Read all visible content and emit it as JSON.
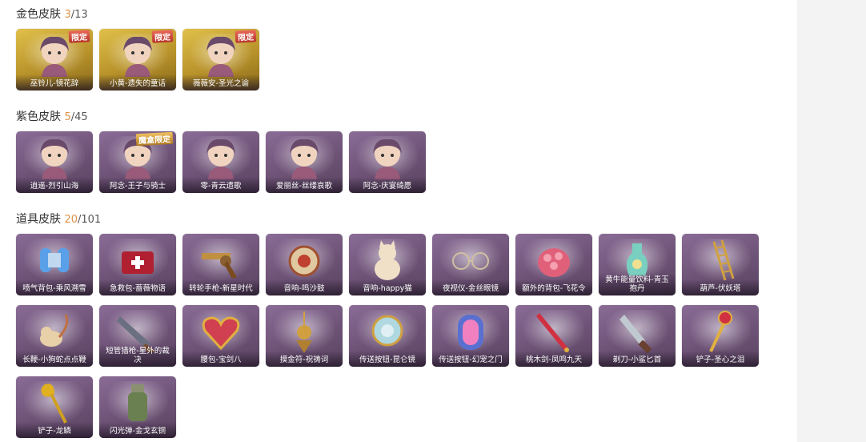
{
  "sections": [
    {
      "title": "金色皮肤",
      "owned": "3",
      "total": "/13",
      "items": [
        {
          "label": "巫铃儿-镜花辞",
          "badge": "限定",
          "icon": "character-portrait"
        },
        {
          "label": "小黄-遗失的童话",
          "badge": "限定",
          "icon": "character-portrait"
        },
        {
          "label": "薇薇安-圣光之谕",
          "badge": "限定",
          "icon": "character-portrait"
        }
      ]
    },
    {
      "title": "紫色皮肤",
      "owned": "5",
      "total": "/45",
      "items": [
        {
          "label": "逍遥-烈引山海",
          "badge": "",
          "icon": "character-portrait"
        },
        {
          "label": "阿念-王子与骑士",
          "badge": "魔盒限定",
          "icon": "character-portrait"
        },
        {
          "label": "零-青云遗歌",
          "badge": "",
          "icon": "character-portrait"
        },
        {
          "label": "爱丽丝-丝缕哀歌",
          "badge": "",
          "icon": "character-portrait"
        },
        {
          "label": "阿念-庆宴绮愿",
          "badge": "",
          "icon": "character-portrait"
        }
      ]
    },
    {
      "title": "道具皮肤",
      "owned": "20",
      "total": "/101",
      "items": [
        {
          "label": "喷气背包-乘风溯雪",
          "badge": "",
          "icon": "jetpack-icon"
        },
        {
          "label": "急救包-蔷薇物语",
          "badge": "",
          "icon": "medkit-icon"
        },
        {
          "label": "转轮手枪-新星时代",
          "badge": "",
          "icon": "revolver-icon"
        },
        {
          "label": "音响-鸣沙鼓",
          "badge": "",
          "icon": "drum-icon"
        },
        {
          "label": "音响-happy猫",
          "badge": "",
          "icon": "cat-speaker-icon"
        },
        {
          "label": "夜视仪-金丝眼镜",
          "badge": "",
          "icon": "glasses-icon"
        },
        {
          "label": "额外的背包-飞花令",
          "badge": "",
          "icon": "flower-backpack-icon"
        },
        {
          "label": "黄牛能量饮料-青玉抱丹",
          "badge": "",
          "icon": "potion-icon"
        },
        {
          "label": "葫芦-伏妖塔",
          "badge": "",
          "icon": "ladder-icon"
        },
        {
          "label": "长鞭-小狗蛇点点鞭",
          "badge": "",
          "icon": "whip-icon"
        },
        {
          "label": "短管猎枪-星外的裁决",
          "badge": "",
          "icon": "shotgun-icon"
        },
        {
          "label": "腰包-宝剑八",
          "badge": "",
          "icon": "heart-pack-icon"
        },
        {
          "label": "摸金符-祝祷词",
          "badge": "",
          "icon": "amulet-icon"
        },
        {
          "label": "传送按钮-昆仑镜",
          "badge": "",
          "icon": "mirror-icon"
        },
        {
          "label": "传送按钮-幻宠之门",
          "badge": "",
          "icon": "portal-icon"
        },
        {
          "label": "桃木剑-凤鸣九天",
          "badge": "",
          "icon": "sword-icon"
        },
        {
          "label": "剃刀-小鲨匕首",
          "badge": "",
          "icon": "dagger-icon"
        },
        {
          "label": "铲子-圣心之泪",
          "badge": "",
          "icon": "scepter-icon"
        },
        {
          "label": "铲子-龙鳞",
          "badge": "",
          "icon": "shovel-icon"
        },
        {
          "label": "闪光弹-金戈玄铜",
          "badge": "",
          "icon": "grenade-icon"
        }
      ]
    }
  ]
}
